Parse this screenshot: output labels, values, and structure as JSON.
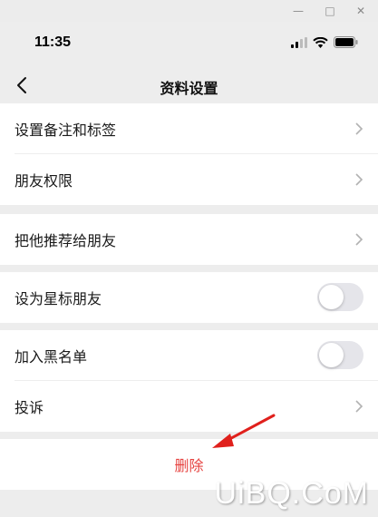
{
  "colors": {
    "page_bg": "#ededed",
    "cell_bg": "#ffffff",
    "delete_text": "#e64340",
    "toggle_off": "#e5e5ea",
    "annotation_arrow": "#e0201c"
  },
  "status": {
    "time": "11:35"
  },
  "nav": {
    "title": "资料设置",
    "back_icon": "chevron-left-icon"
  },
  "group1": {
    "items": [
      {
        "label": "设置备注和标签"
      },
      {
        "label": "朋友权限"
      }
    ]
  },
  "group2": {
    "items": [
      {
        "label": "把他推荐给朋友"
      }
    ]
  },
  "group3": {
    "items": [
      {
        "label": "设为星标朋友",
        "toggle_on": false
      }
    ]
  },
  "group4": {
    "items": [
      {
        "label": "加入黑名单",
        "toggle_on": false
      },
      {
        "label": "投诉"
      }
    ]
  },
  "delete": {
    "label": "删除"
  },
  "watermark": {
    "text": "UiBQ.CoM"
  }
}
